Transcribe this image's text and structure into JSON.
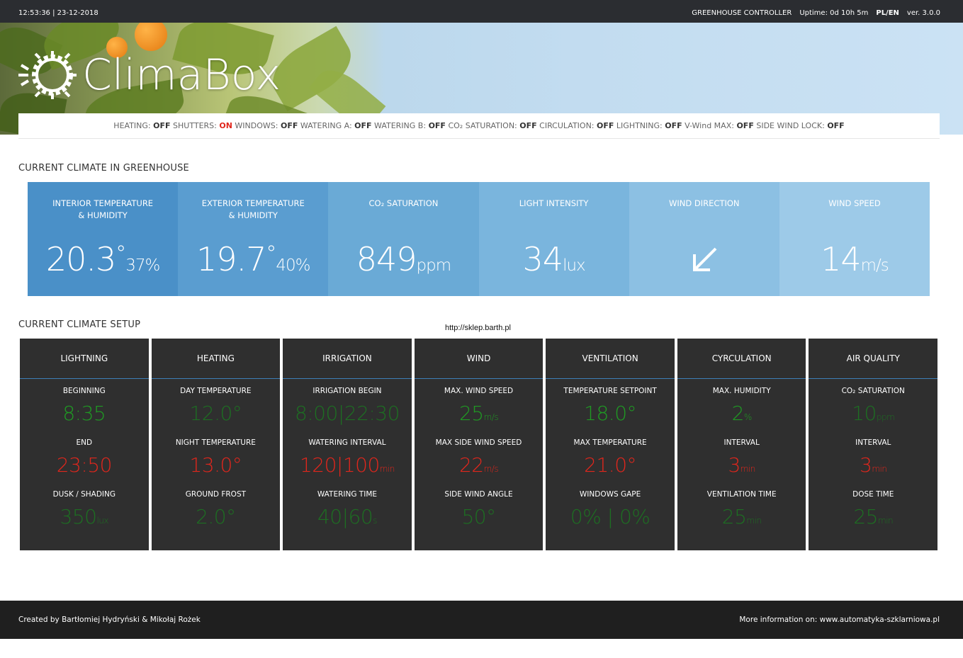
{
  "topbar": {
    "clock": "12:53:36 | 23-12-2018",
    "controller": "GREENHOUSE CONTROLLER",
    "uptime": "Uptime: 0d 10h 5m",
    "lang": "PL/EN",
    "version": "ver. 3.0.0"
  },
  "logo": {
    "text": "ClimaBox"
  },
  "status": [
    {
      "label": "HEATING:",
      "value": "OFF",
      "state": "off"
    },
    {
      "label": "SHUTTERS:",
      "value": "ON",
      "state": "on"
    },
    {
      "label": "WINDOWS:",
      "value": "OFF",
      "state": "off"
    },
    {
      "label": "WATERING A:",
      "value": "OFF",
      "state": "off"
    },
    {
      "label": "WATERING B:",
      "value": "OFF",
      "state": "off"
    },
    {
      "label": "CO₂ SATURATION:",
      "value": "OFF",
      "state": "off"
    },
    {
      "label": "CIRCULATION:",
      "value": "OFF",
      "state": "off"
    },
    {
      "label": "LIGHTNING:",
      "value": "OFF",
      "state": "off"
    },
    {
      "label": "V-Wind MAX:",
      "value": "OFF",
      "state": "off"
    },
    {
      "label": "SIDE WIND LOCK:",
      "value": "OFF",
      "state": "off"
    }
  ],
  "climate_title": "CURRENT CLIMATE IN GREENHOUSE",
  "climate": [
    {
      "label1": "INTERIOR TEMPERATURE",
      "label2": "& HUMIDITY",
      "value": "20.3",
      "unit": "°",
      "small": "37%",
      "bg": "#4a90c8"
    },
    {
      "label1": "EXTERIOR TEMPERATURE",
      "label2": "& HUMIDITY",
      "value": "19.7",
      "unit": "°",
      "small": "40%",
      "bg": "#5a9dd0"
    },
    {
      "label1": "CO₂ SATURATION",
      "label2": "",
      "value": "849",
      "unit": "",
      "small": "ppm",
      "bg": "#6aaad6"
    },
    {
      "label1": "LIGHT INTENSITY",
      "label2": "",
      "value": "34",
      "unit": "",
      "small": "lux",
      "bg": "#7ab5dd"
    },
    {
      "label1": "WIND DIRECTION",
      "label2": "",
      "value": "",
      "unit": "",
      "small": "",
      "bg": "#8cc0e3",
      "icon": "arrow-down-left-icon"
    },
    {
      "label1": "WIND SPEED",
      "label2": "",
      "value": "14",
      "unit": "",
      "small": "m/s",
      "bg": "#9dcae8"
    }
  ],
  "setup_title": "CURRENT CLIMATE SETUP",
  "watermark": "http://sklep.barth.pl",
  "setup": [
    {
      "title": "LIGHTNING",
      "rows": [
        {
          "label": "BEGINNING",
          "value": "8:35",
          "unit": "",
          "color": "g"
        },
        {
          "label": "END",
          "value": "23:50",
          "unit": "",
          "color": "r"
        },
        {
          "label": "DUSK / SHADING",
          "value": "350",
          "unit": "lux",
          "color": "dg"
        }
      ]
    },
    {
      "title": "HEATING",
      "rows": [
        {
          "label": "DAY TEMPERATURE",
          "value": "12.0°",
          "unit": "",
          "color": "dg"
        },
        {
          "label": "NIGHT TEMPERATURE",
          "value": "13.0°",
          "unit": "",
          "color": "r"
        },
        {
          "label": "GROUND FROST",
          "value": "2.0°",
          "unit": "",
          "color": "dg"
        }
      ]
    },
    {
      "title": "IRRIGATION",
      "rows": [
        {
          "label": "IRRIGATION BEGIN",
          "value": "8:00|22:30",
          "unit": "",
          "color": "dg"
        },
        {
          "label": "WATERING INTERVAL",
          "value": "120|100",
          "unit": "min",
          "color": "r"
        },
        {
          "label": "WATERING TIME",
          "value": "40|60",
          "unit": "s",
          "color": "dg"
        }
      ]
    },
    {
      "title": "WIND",
      "rows": [
        {
          "label": "MAX. WIND SPEED",
          "value": "25",
          "unit": "m/s",
          "color": "g"
        },
        {
          "label": "MAX SIDE WIND SPEED",
          "value": "22",
          "unit": "m/s",
          "color": "r"
        },
        {
          "label": "SIDE WIND ANGLE",
          "value": "50°",
          "unit": "",
          "color": "dg"
        }
      ]
    },
    {
      "title": "VENTILATION",
      "rows": [
        {
          "label": "TEMPERATURE SETPOINT",
          "value": "18.0°",
          "unit": "",
          "color": "g"
        },
        {
          "label": "MAX TEMPERATURE",
          "value": "21.0°",
          "unit": "",
          "color": "r"
        },
        {
          "label": "WINDOWS GAPE",
          "value": "0% | 0%",
          "unit": "",
          "color": "dg"
        }
      ]
    },
    {
      "title": "CYRCULATION",
      "rows": [
        {
          "label": "MAX. HUMIDITY",
          "value": "2",
          "unit": "%",
          "color": "g"
        },
        {
          "label": "INTERVAL",
          "value": "3",
          "unit": "min",
          "color": "r"
        },
        {
          "label": "VENTILATION TIME",
          "value": "25",
          "unit": "min",
          "color": "dg"
        }
      ]
    },
    {
      "title": "AIR QUALITY",
      "rows": [
        {
          "label": "CO₂ SATURATION",
          "value": "10",
          "unit": "ppm",
          "color": "dg"
        },
        {
          "label": "INTERVAL",
          "value": "3",
          "unit": "min",
          "color": "r"
        },
        {
          "label": "DOSE TIME",
          "value": "25",
          "unit": "min",
          "color": "dg"
        }
      ]
    }
  ],
  "footer": {
    "credits": "Created by Bartłomiej Hydryński & Mikołaj Rożek",
    "more": "More information on: www.automatyka-szklarniowa.pl"
  }
}
